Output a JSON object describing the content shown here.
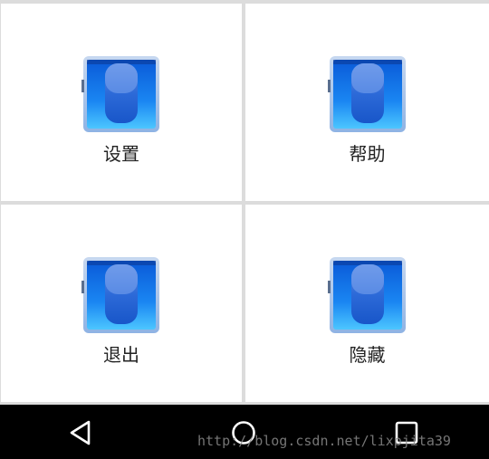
{
  "grid": {
    "items": [
      {
        "label": "设置",
        "icon": "toggle-tile-icon"
      },
      {
        "label": "帮助",
        "icon": "toggle-tile-icon"
      },
      {
        "label": "退出",
        "icon": "toggle-tile-icon"
      },
      {
        "label": "隐藏",
        "icon": "toggle-tile-icon"
      }
    ]
  },
  "navbar": {
    "buttons": [
      {
        "name": "back",
        "icon": "triangle-back-icon"
      },
      {
        "name": "home",
        "icon": "circle-home-icon"
      },
      {
        "name": "recents",
        "icon": "square-recents-icon"
      }
    ]
  },
  "watermark": {
    "text": "http://blog.csdn.net/lixpjita39"
  },
  "colors": {
    "tile_blue": "#1f6fe0",
    "tile_border": "#a9c6ea",
    "nav_background": "#000000",
    "cell_background": "#ffffff",
    "divider": "#dcdcdc"
  }
}
